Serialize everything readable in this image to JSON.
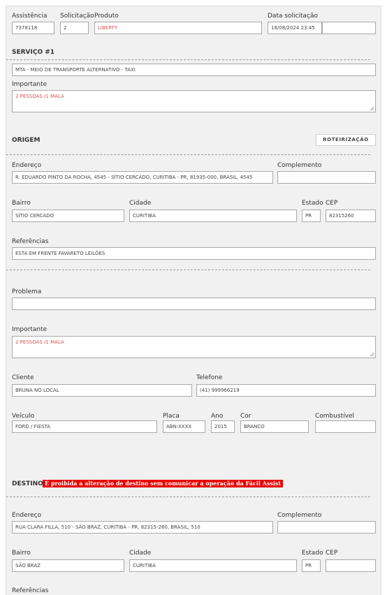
{
  "header": {
    "assistencia_label": "Assistência",
    "assistencia_value": "7378118",
    "solicitacao_label": "Solicitação",
    "solicitacao_value": "2",
    "produto_label": "Produto",
    "produto_value": "LIBERTY",
    "data_label": "Data solicitação",
    "data_value": "18/08/2024 23:45",
    "data_extra_value": ""
  },
  "servico": {
    "title": "SERVIÇO #1",
    "tipo_value": "MTA - MEIO DE TRANSPORTE ALTERNATIVO - TAXI",
    "importante_label": "Importante",
    "importante_value": "2 PESSOAS /1 MALA"
  },
  "origem": {
    "title": "ORIGEM",
    "roteirizacao_label": "ROTEIRIZAÇÃO",
    "endereco_label": "Endereço",
    "endereco_value": "R. EDUARDO PINTO DA ROCHA, 4545 - SÍTIO CERCADO, CURITIBA - PR, 81935-000, BRASIL, 4545",
    "complemento_label": "Complemento",
    "complemento_value": "",
    "bairro_label": "Bairro",
    "bairro_value": "SÍTIO CERCADO",
    "cidade_label": "Cidade",
    "cidade_value": "CURITIBA",
    "estado_label": "Estado",
    "estado_value": "PR",
    "cep_label": "CEP",
    "cep_value": "82315260",
    "referencias_label": "Referências",
    "referencias_value": "ESTA EM FRENTE FAVARETO LEILÕES"
  },
  "detalhes": {
    "problema_label": "Problema",
    "problema_value": "",
    "importante_label": "Importante",
    "importante_value": "2 PESSOAS /1 MALA",
    "cliente_label": "Cliente",
    "cliente_value": "BRUNA  NO LOCAL",
    "telefone_label": "Telefone",
    "telefone_value": "(41) 999966219",
    "veiculo_label": "Veículo",
    "veiculo_value": "FORD / FIESTA",
    "placa_label": "Placa",
    "placa_value": "ABN-XXXX",
    "ano_label": "Ano",
    "ano_value": "2015",
    "cor_label": "Cor",
    "cor_value": "BRANCO",
    "combustivel_label": "Combustível",
    "combustivel_value": ""
  },
  "destino": {
    "title": "DESTINO",
    "warning": "É proibida a alteração de destino sem comunicar a operação da Fácil Assist",
    "endereco_label": "Endereço",
    "endereco_value": "RUA CLARA FILLA, 510 - SÃO BRAZ, CURITIBA - PR, 82315-260, BRASIL, 510",
    "complemento_label": "Complemento",
    "complemento_value": "",
    "bairro_label": "Bairro",
    "bairro_value": "SÃO BRAZ",
    "cidade_label": "Cidade",
    "cidade_value": "CURITIBA",
    "estado_label": "Estado",
    "estado_value": "PR",
    "cep_label": "CEP",
    "cep_value": "",
    "referencias_label": "Referências"
  },
  "colors": {
    "panel": "#f1f1f1",
    "warning_bg": "#e60000",
    "highlight_text": "#d9534f"
  }
}
